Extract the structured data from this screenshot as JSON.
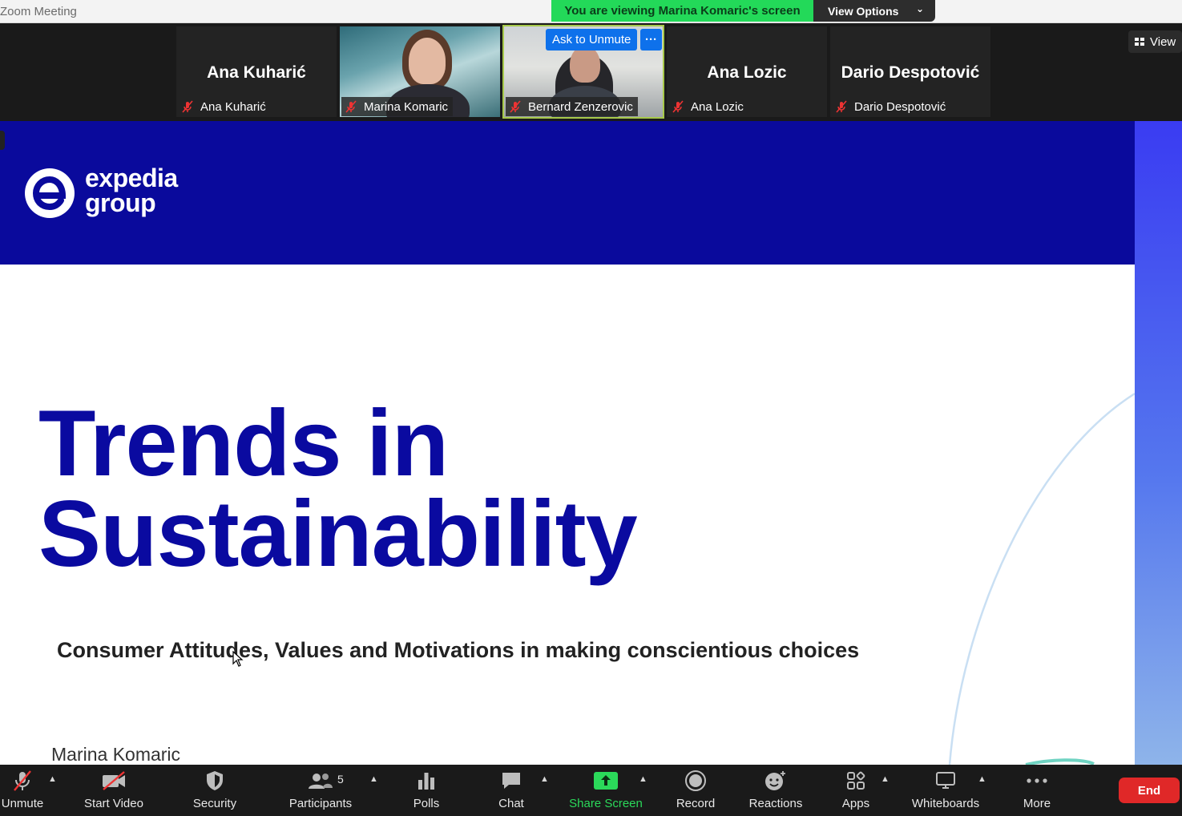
{
  "window": {
    "title": "Zoom Meeting"
  },
  "banner": {
    "viewing_text": "You are viewing Marina Komaric's screen",
    "view_options_label": "View Options"
  },
  "view_button": {
    "label": "View"
  },
  "participants_strip": [
    {
      "big_name": "Ana Kuharić",
      "label": "Ana Kuharić",
      "muted": true,
      "video": false
    },
    {
      "big_name": "",
      "label": "Marina Komaric",
      "muted": true,
      "video": true
    },
    {
      "big_name": "",
      "label": "Bernard Zenzerovic",
      "muted": true,
      "video": true,
      "active": true
    },
    {
      "big_name": "Ana Lozic",
      "label": "Ana Lozic",
      "muted": true,
      "video": false
    },
    {
      "big_name": "Dario Despotović",
      "label": "Dario Despotović",
      "muted": true,
      "video": false
    }
  ],
  "tile_actions": {
    "ask_to_unmute": "Ask to Unmute",
    "more": "···"
  },
  "slide": {
    "logo_line1": "expedia",
    "logo_line2": "group",
    "title_line1": "Trends in",
    "title_line2": "Sustainability",
    "subtitle": "Consumer Attitudes, Values and Motivations in making conscientious choices",
    "author": "Marina Komaric",
    "colors": {
      "header": "#0a0a9c",
      "title": "#0a0aa0"
    }
  },
  "toolbar": {
    "unmute": "Unmute",
    "start_video": "Start Video",
    "security": "Security",
    "participants": "Participants",
    "participants_count": "5",
    "polls": "Polls",
    "chat": "Chat",
    "share_screen": "Share Screen",
    "record": "Record",
    "reactions": "Reactions",
    "apps": "Apps",
    "whiteboards": "Whiteboards",
    "more": "More",
    "end": "End"
  }
}
